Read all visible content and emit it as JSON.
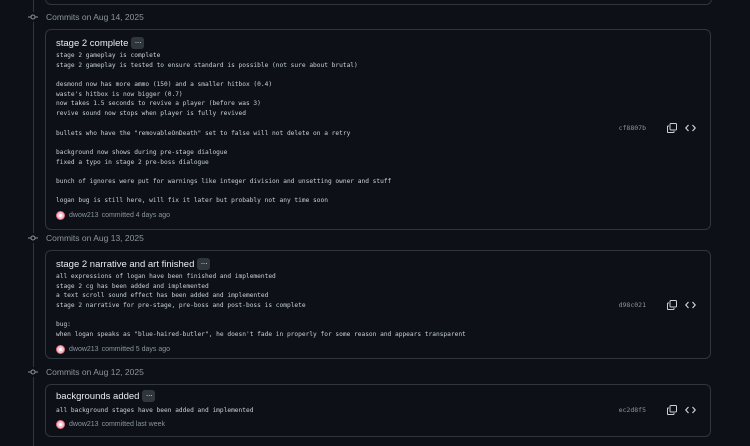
{
  "day_groups": [
    {
      "header": "Commits on Aug 14, 2025",
      "commit": {
        "title": "stage 2 complete",
        "body": [
          "stage 2 gameplay is complete",
          "stage 2 gameplay is tested to ensure standard is possible (not sure about brutal)",
          "",
          "desmond now has more ammo (150) and a smaller hitbox (0.4)",
          "waste's hitbox is now bigger (0.7)",
          "now takes 1.5 seconds to revive a player (before was 3)",
          "revive sound now stops when player is fully revived",
          "",
          "bullets who have the \"removableOnDeath\" set to false will not delete on a retry",
          "",
          "background now shows during pre-stage dialogue",
          "fixed a typo in stage 2 pre-boss dialogue",
          "",
          "bunch of ignores were put for warnings like integer division and unsetting owner and stuff",
          "",
          "logan bug is still here, will fix it later but probably not any time soon"
        ],
        "author": "dwow213",
        "committed_text": "committed 4 days ago",
        "sha": "cf8807b"
      }
    },
    {
      "header": "Commits on Aug 13, 2025",
      "commit": {
        "title": "stage 2 narrative and art finished",
        "body": [
          "all expressions of logan have been finished and implemented",
          "stage 2 cg has been added and implemented",
          "a text scroll sound effect has been added and implemented",
          "stage 2 narrative for pre-stage, pre-boss and post-boss is complete",
          "",
          "bug:",
          "when logan speaks as \"blue-haired-butler\", he doesn't fade in properly for some reason and appears transparent"
        ],
        "author": "dwow213",
        "committed_text": "committed 5 days ago",
        "sha": "d98c021"
      }
    },
    {
      "header": "Commits on Aug 12, 2025",
      "commit": {
        "title": "backgrounds added",
        "body": [
          "all background stages have been added and implemented"
        ],
        "author": "dwow213",
        "committed_text": "committed last week",
        "sha": "ec2d8f5"
      }
    }
  ],
  "icons": {
    "commit_node": "git-commit-icon",
    "copy": "copy-icon",
    "browse": "code-icon",
    "ellipsis": "ellipsis-icon",
    "avatar": "user-avatar"
  },
  "colors": {
    "background": "#0d1117",
    "border": "#30363d",
    "text": "#e6edf3",
    "muted": "#8b949e"
  }
}
